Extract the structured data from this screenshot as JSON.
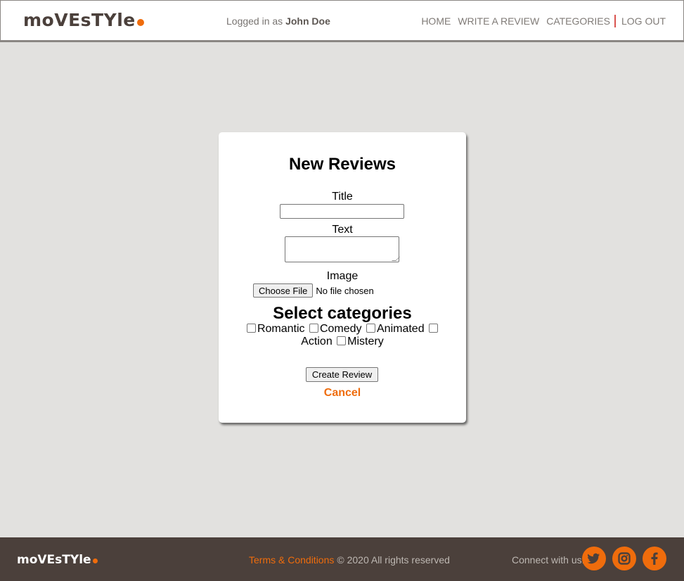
{
  "header": {
    "logo_text": "moVEsTYle",
    "logged_prefix": "Logged in as",
    "user_name": "John Doe",
    "nav": [
      "HOME",
      "WRITE A REVIEW",
      "CATEGORIES",
      "LOG OUT"
    ]
  },
  "form": {
    "heading": "New Reviews",
    "title_label": "Title",
    "title_value": "",
    "text_label": "Text",
    "text_value": "",
    "image_label": "Image",
    "file_button": "Choose File",
    "file_status": "No file chosen",
    "categories_heading": "Select categories",
    "categories": [
      "Romantic",
      "Comedy",
      "Animated",
      "Action",
      "Mistery"
    ],
    "submit_label": "Create Review",
    "cancel_label": "Cancel"
  },
  "footer": {
    "logo_text": "moVEsTYle",
    "terms_link": "Terms & Conditions",
    "copyright": "© 2020 All rights reserved",
    "connect_label": "Connect with us:",
    "social": [
      "twitter-icon",
      "instagram-icon",
      "facebook-icon"
    ]
  },
  "colors": {
    "accent": "#ef6c0c",
    "footer_bg": "#4b403b",
    "page_bg": "#e2e1df"
  }
}
